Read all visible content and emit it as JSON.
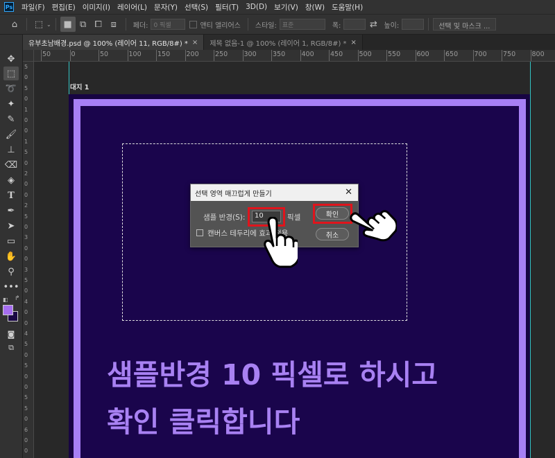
{
  "menu": [
    "파일(F)",
    "편집(E)",
    "이미지(I)",
    "레이어(L)",
    "문자(Y)",
    "선택(S)",
    "필터(T)",
    "3D(D)",
    "보기(V)",
    "창(W)",
    "도움말(H)"
  ],
  "app_logo": "Ps",
  "options": {
    "feather_label": "페더:",
    "feather_value": "0 픽셀",
    "antialias_label": "앤티 앨리어스",
    "style_label": "스타일:",
    "style_value": "표준",
    "width_label": "폭:",
    "height_label": "높이:",
    "select_mask_label": "선택 및 마스크 ..."
  },
  "tabs": [
    {
      "label": "유부초남배경.psd @ 100% (레이어 11, RGB/8#) *",
      "active": true
    },
    {
      "label": "제목 없음-1 @ 100% (레이어 1, RGB/8#) *",
      "active": false
    }
  ],
  "tab_close": "×",
  "ruler": {
    "top_labels": [
      "50",
      "0",
      "50",
      "100",
      "150",
      "200",
      "250",
      "300",
      "350",
      "400",
      "450",
      "500",
      "550",
      "600",
      "650",
      "700",
      "750",
      "800"
    ],
    "left_labels": [
      "5",
      "0",
      "5",
      "0",
      "1",
      "0",
      "0",
      "1",
      "5",
      "0",
      "2",
      "0",
      "0",
      "2",
      "5",
      "0",
      "3",
      "0",
      "0",
      "3",
      "5",
      "0",
      "4",
      "0",
      "0",
      "4",
      "5",
      "0",
      "5",
      "0",
      "0",
      "5",
      "5",
      "0",
      "6",
      "0",
      "0"
    ]
  },
  "artboard_label": "대지 1",
  "canvas_text": {
    "line1": "샘플반경 10 픽셀로 하시고",
    "line2": "확인 클릭합니다"
  },
  "dialog": {
    "title": "선택 영역 매끄럽게 만들기",
    "close": "✕",
    "radius_label": "샘플 반경(S):",
    "radius_value": "10",
    "unit": "픽셀",
    "ok_label": "확인",
    "cancel_label": "취소",
    "apply_canvas_label": "캔버스 테두리에 효과 적용"
  },
  "colors": {
    "accent_purple": "#a881f2",
    "canvas_bg": "#1a054c",
    "highlight_red": "#e0141c",
    "fg_swatch": "#a66ef0",
    "bg_swatch": "#1a0845"
  }
}
